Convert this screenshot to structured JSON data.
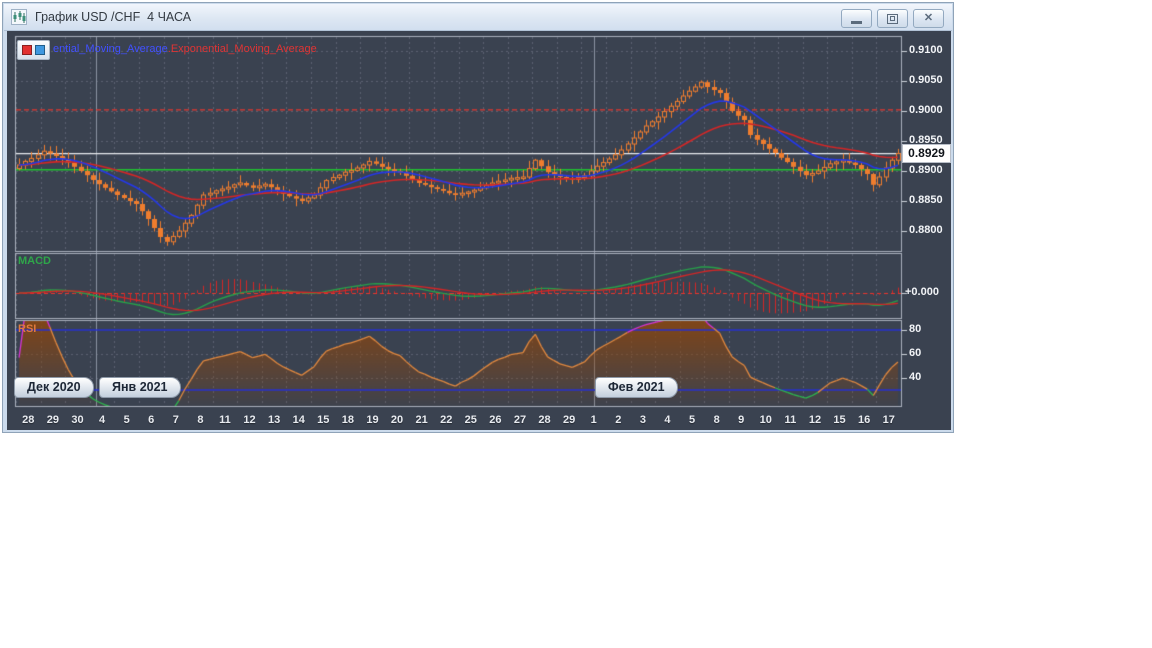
{
  "window": {
    "title": "График USD /CHF  4 ЧАСА",
    "icon": "candlestick-chart-icon",
    "buttons": {
      "minimize": "minimize",
      "restore": "restore",
      "close_glyph": "✕"
    }
  },
  "legend": {
    "blue_label": "ential_Moving_Average",
    "separator": ".",
    "red_label": "Exponential_Moving_Average"
  },
  "panels": {
    "macd_label": "MACD",
    "rsi_label": "RSI",
    "macd_zero_label": "+0.000"
  },
  "price_box": {
    "value": "0.8929"
  },
  "axes": {
    "price_ticks": [
      "0.9100",
      "0.9050",
      "0.9000",
      "0.8950",
      "0.8900",
      "0.8850",
      "0.8800"
    ],
    "rsi_ticks": [
      "80",
      "60",
      "40"
    ],
    "day_labels": [
      "28",
      "29",
      "30",
      "4",
      "5",
      "6",
      "7",
      "8",
      "11",
      "12",
      "13",
      "14",
      "15",
      "18",
      "19",
      "20",
      "21",
      "22",
      "25",
      "26",
      "27",
      "28",
      "29",
      "1",
      "2",
      "3",
      "4",
      "5",
      "8",
      "9",
      "10",
      "11",
      "12",
      "15",
      "16",
      "17"
    ],
    "month_markers": [
      {
        "label": "Дек 2020",
        "x": 7,
        "separator_index": -1
      },
      {
        "label": "Янв 2021",
        "x": 92,
        "separator_index": 13
      },
      {
        "label": "Фев 2021",
        "x": 588,
        "separator_index": 94
      }
    ]
  },
  "chart_data": {
    "type": "candlestick",
    "symbol": "USD/CHF",
    "timeframe": "4 часа",
    "title": "График USD /CHF 4 ЧАСА",
    "ylim": [
      0.8775,
      0.9105
    ],
    "candles_per_day": 4,
    "first_open": 0.8904,
    "closes": [
      0.891,
      0.8916,
      0.8921,
      0.8927,
      0.8933,
      0.8929,
      0.8925,
      0.892,
      0.8914,
      0.8907,
      0.89,
      0.8893,
      0.8885,
      0.8878,
      0.8872,
      0.8866,
      0.886,
      0.8855,
      0.885,
      0.8845,
      0.8833,
      0.882,
      0.8805,
      0.879,
      0.8782,
      0.8791,
      0.88,
      0.8813,
      0.8826,
      0.8843,
      0.886,
      0.8863,
      0.8867,
      0.887,
      0.8873,
      0.8877,
      0.888,
      0.8876,
      0.8872,
      0.8875,
      0.8878,
      0.8873,
      0.8867,
      0.8862,
      0.8858,
      0.8854,
      0.885,
      0.8855,
      0.886,
      0.8872,
      0.8884,
      0.8889,
      0.8893,
      0.8898,
      0.8901,
      0.8905,
      0.891,
      0.8916,
      0.8912,
      0.8907,
      0.8903,
      0.89,
      0.8898,
      0.8892,
      0.8886,
      0.888,
      0.8877,
      0.8873,
      0.887,
      0.8867,
      0.8863,
      0.886,
      0.8863,
      0.8865,
      0.8868,
      0.8872,
      0.8876,
      0.888,
      0.8883,
      0.8885,
      0.8888,
      0.8889,
      0.889,
      0.8904,
      0.8918,
      0.8908,
      0.8898,
      0.8894,
      0.889,
      0.8888,
      0.8886,
      0.8889,
      0.8892,
      0.89,
      0.8908,
      0.8914,
      0.892,
      0.8927,
      0.8935,
      0.8945,
      0.8955,
      0.8965,
      0.8975,
      0.8982,
      0.899,
      0.8999,
      0.9008,
      0.9016,
      0.9025,
      0.9033,
      0.904,
      0.9048,
      0.904,
      0.9035,
      0.903,
      0.9015,
      0.9,
      0.8992,
      0.8985,
      0.896,
      0.8952,
      0.8945,
      0.8937,
      0.893,
      0.8922,
      0.8915,
      0.8907,
      0.89,
      0.8893,
      0.8896,
      0.89,
      0.8906,
      0.8912,
      0.8915,
      0.8918,
      0.8914,
      0.891,
      0.8903,
      0.8895,
      0.8877,
      0.889,
      0.8905,
      0.8918,
      0.8929
    ],
    "current_price": 0.8929,
    "levels": {
      "resistance_dashed_red": 0.9002,
      "support_green": 0.8902,
      "bid_line_white": 0.8929
    },
    "overlays": [
      {
        "name": "Exponential_Moving_Average",
        "period": 12,
        "color": "#2438e8"
      },
      {
        "name": "Exponential_Moving_Average",
        "period": 30,
        "color": "#d42626"
      }
    ],
    "indicators": {
      "macd": {
        "fast": 12,
        "slow": 26,
        "signal": 9,
        "zero_label": "+0.000",
        "line_color": "#27a04a",
        "signal_color": "#d42626",
        "hist_color": "#d42626"
      },
      "rsi": {
        "period": 14,
        "levels": [
          80,
          30
        ],
        "ticks": [
          80,
          60,
          40
        ],
        "line_color": "#e2893f",
        "overbought_color": "#d633d6",
        "oversold_color": "#2db84d",
        "band_color": "#2730cf"
      }
    },
    "colors": {
      "background": "#3a4250",
      "grid": "#5a6170",
      "panel_border": "#a9b0bc",
      "candle": "#ef7d2e",
      "separator": "#8a93a2",
      "price_line": "#e9ecef",
      "axis_text": "#f2f4f7"
    }
  }
}
